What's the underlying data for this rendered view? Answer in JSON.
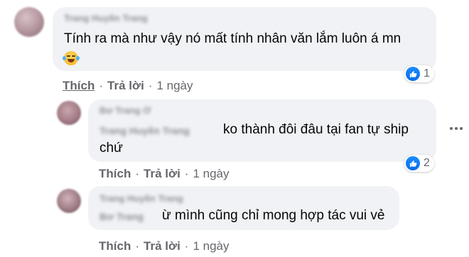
{
  "comments": [
    {
      "author": "Trang Huyền Trang",
      "text": "Tính ra mà như vậy nó mất tính nhân văn lắm luôn á mn",
      "reaction_count": "1",
      "actions": {
        "like": "Thích",
        "reply": "Trả lời",
        "time": "1 ngày"
      }
    },
    {
      "author": "Bơ Trang Ơ",
      "tag": "Trang Huyền Trang",
      "text_line1": "ko thành đôi đâu tại fan tự ship",
      "text_line2": "chứ",
      "reaction_count": "2",
      "actions": {
        "like": "Thích",
        "reply": "Trả lời",
        "time": "1 ngày"
      }
    },
    {
      "author": "Trang Huyền Trang",
      "tag": "Bơ Trang",
      "text": "ừ mình cũng chỉ mong hợp tác vui vẻ",
      "actions": {
        "like": "Thích",
        "reply": "Trả lời",
        "time": "1 ngày"
      }
    }
  ],
  "dot": "·",
  "colors": {
    "like_blue": "#1877f2",
    "bubble": "#f0f2f5",
    "meta": "#65676b"
  },
  "icons": {
    "reaction": "like-icon",
    "emoji": "laughing-tears-emoji",
    "menu": "more-options-icon"
  }
}
